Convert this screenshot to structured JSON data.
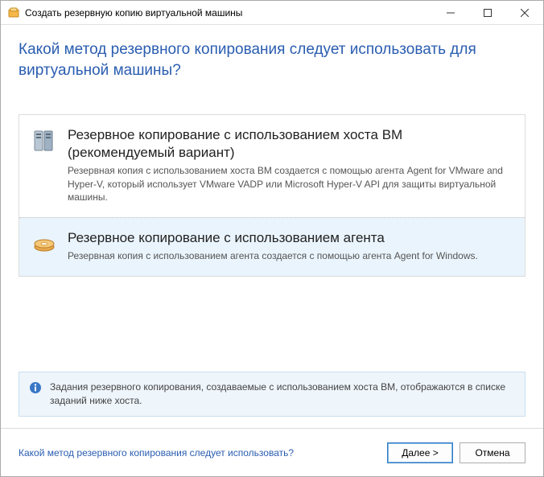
{
  "window": {
    "title": "Создать резервную копию виртуальной машины"
  },
  "heading": "Какой метод резервного копирования следует использовать для виртуальной машины?",
  "options": [
    {
      "title": "Резервное копирование с использованием хоста ВМ (рекомендуемый вариант)",
      "desc": "Резервная копия с использованием хоста ВМ создается с помощью агента Agent for VMware and Hyper-V, который использует VMware VADP или Microsoft Hyper-V API для защиты виртуальной машины."
    },
    {
      "title": "Резервное копирование с использованием агента",
      "desc": "Резервная копия с использованием агента создается с помощью агента Agent for Windows."
    }
  ],
  "info": "Задания резервного копирования, создаваемые с использованием хоста ВМ, отображаются в списке заданий ниже хоста.",
  "footer": {
    "help_link": "Какой метод резервного копирования следует использовать?",
    "next": "Далее >",
    "cancel": "Отмена"
  }
}
